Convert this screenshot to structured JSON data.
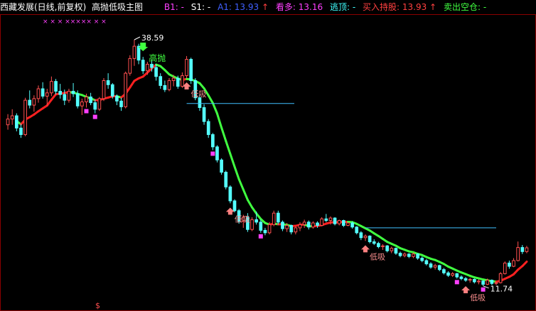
{
  "header": {
    "stock_name": "西藏发展(日线,前复权)",
    "indicator_name": "高抛低吸主图",
    "b1_label": "B1:",
    "b1_value": "-",
    "s1_label": "S1:",
    "s1_value": "-",
    "a1_label": "A1:",
    "a1_value": "13.93",
    "kanduo_label": "看多:",
    "kanduo_value": "13.16",
    "taoding_label": "逃顶:",
    "taoding_value": "-",
    "buy_hold_label": "买入持股:",
    "buy_hold_value": "13.93",
    "sell_empty_label": "卖出空仓:",
    "sell_empty_value": "-",
    "up_arrow": "↑"
  },
  "colors": {
    "up_candle": "#ff5050",
    "down_candle": "#54ffff",
    "ma_up": "#ff2020",
    "ma_down": "#40ff40",
    "header_white": "#ffffff",
    "header_magenta": "#ff40ff",
    "header_blue": "#4060ff",
    "header_red": "#ff4040",
    "header_cyan": "#40ffff",
    "header_green": "#40ff40",
    "marker_magenta": "#ff40ff",
    "annotation_white": "#ffffff"
  },
  "chart_data": {
    "type": "candlestick",
    "annotations": {
      "high_price": "38.59",
      "low_price": "11.74",
      "sell_signal": "高抛",
      "buy_signal_1": "低吸",
      "buy_signal_2": "低吸",
      "buy_signal_3": "低吸",
      "buy_signal_4": "低吸",
      "top_marks": "× ×  ×  ×××××  × ×",
      "bottom_mark": "$"
    },
    "ohlc": [
      [
        28.2,
        29.5,
        27.6,
        28.9
      ],
      [
        28.9,
        30.1,
        28.2,
        29.3
      ],
      [
        29.3,
        29.6,
        27.4,
        27.8
      ],
      [
        27.8,
        28.3,
        26.6,
        27.0
      ],
      [
        27.0,
        31.5,
        26.8,
        31.2
      ],
      [
        31.2,
        32.4,
        30.2,
        30.6
      ],
      [
        30.6,
        31.8,
        29.8,
        31.4
      ],
      [
        31.4,
        33.0,
        30.9,
        32.6
      ],
      [
        32.6,
        33.4,
        31.4,
        31.7
      ],
      [
        31.7,
        32.6,
        30.5,
        32.1
      ],
      [
        32.1,
        34.1,
        31.7,
        33.5
      ],
      [
        33.5,
        33.8,
        31.9,
        32.3
      ],
      [
        32.3,
        33.2,
        31.4,
        31.9
      ],
      [
        31.9,
        32.5,
        30.6,
        31.2
      ],
      [
        31.2,
        32.6,
        30.9,
        32.3
      ],
      [
        32.3,
        33.3,
        31.6,
        32.0
      ],
      [
        32.0,
        32.4,
        30.2,
        30.5
      ],
      [
        30.5,
        31.4,
        29.4,
        31.0
      ],
      [
        31.0,
        32.0,
        30.3,
        31.6
      ],
      [
        31.6,
        32.1,
        30.6,
        30.9
      ],
      [
        30.9,
        31.3,
        29.6,
        30.1
      ],
      [
        30.1,
        31.6,
        29.9,
        31.4
      ],
      [
        31.4,
        33.9,
        31.1,
        33.6
      ],
      [
        33.6,
        34.5,
        32.6,
        33.1
      ],
      [
        33.1,
        33.3,
        31.4,
        31.7
      ],
      [
        31.7,
        31.9,
        30.6,
        31.1
      ],
      [
        31.1,
        31.5,
        29.9,
        30.4
      ],
      [
        30.4,
        34.7,
        30.2,
        34.5
      ],
      [
        34.5,
        36.7,
        34.2,
        36.3
      ],
      [
        36.3,
        38.59,
        35.4,
        37.8
      ],
      [
        37.8,
        38.1,
        35.6,
        36.1
      ],
      [
        36.1,
        36.5,
        34.4,
        34.8
      ],
      [
        34.8,
        35.9,
        34.3,
        35.6
      ],
      [
        35.6,
        36.2,
        34.7,
        35.2
      ],
      [
        35.2,
        35.6,
        33.6,
        34.1
      ],
      [
        34.1,
        34.5,
        32.6,
        33.0
      ],
      [
        33.0,
        33.6,
        32.2,
        32.5
      ],
      [
        32.5,
        33.9,
        32.3,
        33.6
      ],
      [
        33.6,
        34.3,
        32.9,
        33.9
      ],
      [
        33.9,
        34.2,
        32.6,
        32.9
      ],
      [
        32.9,
        34.6,
        32.7,
        34.2
      ],
      [
        34.2,
        36.6,
        33.9,
        36.2
      ],
      [
        36.2,
        36.4,
        33.2,
        33.6
      ],
      [
        33.6,
        33.9,
        31.2,
        31.5
      ],
      [
        31.5,
        31.9,
        29.9,
        30.3
      ],
      [
        30.3,
        30.7,
        28.2,
        28.6
      ],
      [
        28.6,
        28.9,
        26.6,
        27.0
      ],
      [
        27.0,
        27.2,
        25.1,
        25.5
      ],
      [
        25.5,
        25.7,
        23.6,
        23.9
      ],
      [
        23.9,
        24.1,
        22.1,
        22.4
      ],
      [
        22.4,
        22.6,
        20.3,
        20.6
      ],
      [
        20.6,
        20.8,
        18.6,
        18.9
      ],
      [
        18.9,
        19.1,
        17.5,
        17.7
      ],
      [
        17.7,
        17.9,
        16.1,
        16.4
      ],
      [
        16.4,
        17.2,
        15.6,
        16.9
      ],
      [
        16.9,
        17.4,
        15.1,
        15.4
      ],
      [
        15.4,
        16.9,
        15.2,
        16.6
      ],
      [
        16.6,
        17.6,
        16.0,
        16.3
      ],
      [
        16.3,
        16.6,
        15.0,
        15.3
      ],
      [
        15.3,
        15.6,
        14.7,
        15.0
      ],
      [
        15.0,
        16.3,
        14.8,
        16.0
      ],
      [
        16.0,
        17.7,
        15.8,
        17.4
      ],
      [
        17.4,
        17.7,
        16.0,
        16.3
      ],
      [
        16.3,
        16.5,
        15.2,
        15.5
      ],
      [
        15.5,
        16.2,
        15.1,
        15.9
      ],
      [
        15.9,
        16.0,
        14.8,
        15.1
      ],
      [
        15.1,
        15.8,
        14.8,
        15.6
      ],
      [
        15.6,
        16.3,
        15.2,
        16.0
      ],
      [
        16.0,
        16.6,
        15.6,
        16.3
      ],
      [
        16.3,
        16.5,
        15.4,
        15.7
      ],
      [
        15.7,
        16.4,
        15.5,
        16.2
      ],
      [
        16.2,
        16.4,
        15.6,
        15.9
      ],
      [
        15.9,
        16.9,
        15.8,
        16.7
      ],
      [
        16.7,
        17.3,
        16.3,
        16.5
      ],
      [
        16.5,
        17.0,
        16.0,
        16.8
      ],
      [
        16.8,
        16.9,
        15.9,
        16.1
      ],
      [
        16.1,
        16.6,
        15.9,
        16.5
      ],
      [
        16.5,
        16.6,
        15.7,
        15.9
      ],
      [
        15.9,
        16.3,
        15.8,
        16.2
      ],
      [
        16.2,
        16.4,
        15.5,
        15.7
      ],
      [
        15.7,
        15.8,
        14.8,
        15.0
      ],
      [
        15.0,
        15.2,
        14.1,
        14.4
      ],
      [
        14.4,
        14.8,
        14.0,
        14.6
      ],
      [
        14.6,
        14.7,
        13.7,
        13.9
      ],
      [
        13.9,
        14.2,
        13.5,
        13.7
      ],
      [
        13.7,
        13.9,
        13.1,
        13.3
      ],
      [
        13.3,
        13.6,
        12.9,
        13.4
      ],
      [
        13.4,
        13.5,
        12.6,
        12.8
      ],
      [
        12.8,
        13.3,
        12.5,
        13.1
      ],
      [
        13.1,
        13.2,
        12.3,
        12.5
      ],
      [
        12.5,
        12.7,
        12.0,
        12.2
      ],
      [
        12.2,
        12.6,
        12.0,
        12.4
      ],
      [
        12.4,
        12.5,
        11.9,
        12.1
      ],
      [
        12.1,
        12.6,
        11.9,
        12.4
      ],
      [
        12.4,
        12.5,
        11.7,
        11.9
      ],
      [
        11.9,
        12.1,
        11.4,
        11.6
      ],
      [
        11.6,
        11.8,
        11.0,
        11.2
      ],
      [
        11.2,
        11.4,
        10.6,
        10.8
      ],
      [
        10.8,
        11.2,
        10.5,
        11.0
      ],
      [
        11.0,
        11.1,
        10.3,
        10.5
      ],
      [
        10.5,
        10.7,
        9.9,
        10.1
      ],
      [
        10.1,
        10.3,
        9.6,
        9.8
      ],
      [
        9.8,
        10.2,
        9.6,
        10.0
      ],
      [
        10.0,
        10.1,
        9.4,
        9.6
      ],
      [
        9.6,
        9.8,
        9.2,
        9.4
      ],
      [
        9.4,
        9.6,
        9.0,
        9.2
      ],
      [
        9.2,
        9.5,
        8.9,
        9.3
      ],
      [
        9.3,
        9.4,
        8.8,
        9.0
      ],
      [
        9.0,
        9.3,
        8.7,
        9.1
      ],
      [
        9.1,
        9.2,
        8.5,
        8.7
      ],
      [
        8.7,
        9.4,
        8.6,
        9.2
      ],
      [
        9.2,
        9.3,
        8.6,
        8.8
      ],
      [
        8.8,
        9.0,
        8.6,
        8.9
      ],
      [
        8.9,
        10.2,
        8.8,
        10.0
      ],
      [
        10.0,
        11.5,
        9.9,
        11.3
      ],
      [
        11.3,
        11.6,
        10.6,
        10.9
      ],
      [
        10.9,
        11.9,
        10.8,
        11.6
      ],
      [
        11.6,
        13.93,
        11.5,
        13.2
      ],
      [
        13.2,
        13.5,
        12.4,
        12.7
      ],
      [
        12.7,
        13.4,
        12.5,
        13.16
      ]
    ]
  }
}
